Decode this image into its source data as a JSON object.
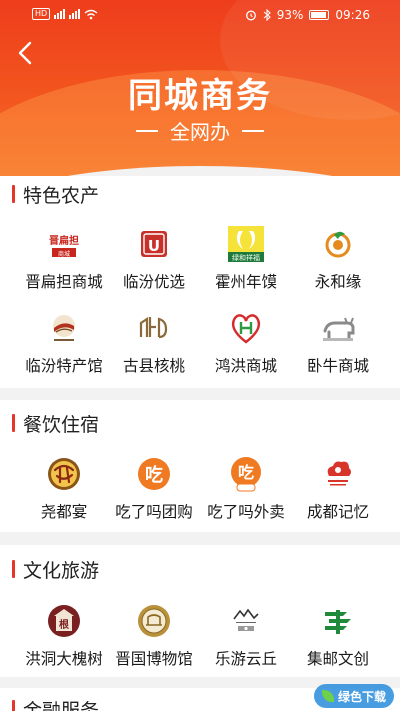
{
  "status": {
    "left_badge": "HD",
    "battery": "93%",
    "time": "09:26"
  },
  "header": {
    "title": "同城商务",
    "subtitle": "全网办"
  },
  "sections": [
    {
      "title": "特色农产",
      "items": [
        {
          "label": "晋扁担商城",
          "icon": "jin-biandan-logo",
          "icon_text": "晋扁担"
        },
        {
          "label": "临汾优选",
          "icon": "linfen-youxuan-logo",
          "icon_text": "U"
        },
        {
          "label": "霍州年馍",
          "icon": "huozhou-nianmo-logo",
          "icon_text": "绿和祥福"
        },
        {
          "label": "永和缘",
          "icon": "yonghe-yuan-logo",
          "icon_text": ""
        },
        {
          "label": "临汾特产馆",
          "icon": "linfen-techan-logo",
          "icon_text": ""
        },
        {
          "label": "古县核桃",
          "icon": "guxian-hetao-logo",
          "icon_text": ""
        },
        {
          "label": "鸿洪商城",
          "icon": "honghong-logo",
          "icon_text": "H"
        },
        {
          "label": "卧牛商城",
          "icon": "woniu-logo",
          "icon_text": ""
        }
      ]
    },
    {
      "title": "餐饮住宿",
      "items": [
        {
          "label": "尧都宴",
          "icon": "yaodu-yan-logo",
          "icon_text": ""
        },
        {
          "label": "吃了吗团购",
          "icon": "chilema-tuangou-logo",
          "icon_text": "吃"
        },
        {
          "label": "吃了吗外卖",
          "icon": "chilema-waimai-logo",
          "icon_text": "吃"
        },
        {
          "label": "成都记忆",
          "icon": "chengdu-jiyi-logo",
          "icon_text": ""
        }
      ]
    },
    {
      "title": "文化旅游",
      "items": [
        {
          "label": "洪洞大槐树",
          "icon": "dahuaishu-logo",
          "icon_text": "根"
        },
        {
          "label": "晋国博物馆",
          "icon": "jinguo-museum-logo",
          "icon_text": ""
        },
        {
          "label": "乐游云丘",
          "icon": "leyou-yunqiu-logo",
          "icon_text": ""
        },
        {
          "label": "集邮文创",
          "icon": "jiyou-wenchuang-logo",
          "icon_text": ""
        }
      ]
    },
    {
      "title": "金融服务"
    }
  ],
  "watermark": "绿色下载",
  "colors": {
    "accent": "#e8352a",
    "header": "#f3571f"
  }
}
